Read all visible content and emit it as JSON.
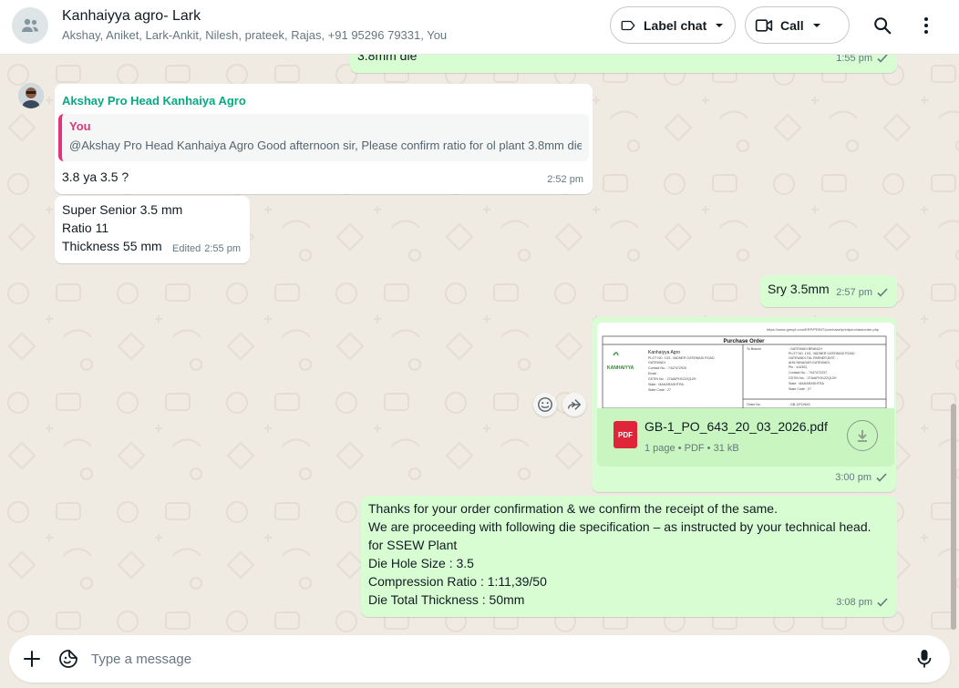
{
  "header": {
    "title": "Kanhaiyya agro- Lark",
    "members": "Akshay, Aniket, Lark-Ankit, Nilesh, prateek, Rajas, +91 95296 79331, You",
    "label_chat": "Label chat",
    "call": "Call"
  },
  "messages": {
    "m0": {
      "text": "3.8mm die",
      "time": "1:55 pm"
    },
    "m1": {
      "sender": "Akshay Pro Head Kanhaiya Agro",
      "quote_author": "You",
      "quote_text": "@Akshay Pro Head Kanhaiya Agro Good afternoon sir, Please confirm ratio for ol plant 3.8mm die",
      "text": "3.8 ya 3.5 ?",
      "time": "2:52 pm"
    },
    "m2": {
      "lines": [
        "Super Senior 3.5 mm",
        "Ratio 11",
        "Thickness 55 mm"
      ],
      "edited": "Edited",
      "time": "2:55 pm"
    },
    "m3": {
      "text": "Sry 3.5mm",
      "time": "2:57 pm"
    },
    "m4": {
      "preview": {
        "url": "https://www.gmcpl.com/ERP/PRINT/purchase/printpurchaseorder.php",
        "heading": "Purchase Order",
        "logo": "KANHAIYYA",
        "company": "Kanhaiyya Agro",
        "address_lines": [
          "PLOT NO. 13/1, VADNER GATEWADI ROAD",
          "GATEWADI",
          "Contact No. : 7447472933",
          "Email :",
          "GSTIN No. : 27AAIFK9122Q1ZH",
          "State : MAHARASHTRA",
          "State Code : 27"
        ],
        "to_branch": "To Branch",
        "to_lines": [
          ": GATEWADI BRANCH",
          "PLOT NO. 13/1, VADNER GATEWADI ROAD",
          "GATEWADI,TAL.PARNER,DIST. -",
          "AHILYANAGAR,GATEWADI,",
          "Pin : 414302,",
          "Contact No. : 7447472237,",
          "GSTIN No. : 27AAIFK9122Q1ZH",
          "State : MAHARASHTRA",
          "State Code : 27"
        ],
        "order_no_label": "Order No.",
        "order_no": ": GB-1/PO/643"
      },
      "file_name": "GB-1_PO_643_20_03_2026.pdf",
      "file_meta": "1 page • PDF • 31 kB",
      "pdf_badge": "PDF",
      "time": "3:00 pm"
    },
    "m5": {
      "lines": [
        "Thanks for your order confirmation & we confirm the receipt of the same.",
        "We are proceeding with following die specification –  as instructed by your technical head.",
        "for SSEW Plant",
        "Die Hole Size : 3.5",
        "Compression Ratio : 1:11,39/50",
        "Die Total Thickness : 50mm"
      ],
      "time": "3:08 pm"
    }
  },
  "composer": {
    "placeholder": "Type a message"
  },
  "icons": {
    "group_avatar": "group-icon",
    "label": "label-icon",
    "call": "video-call-icon",
    "search": "search-icon",
    "menu": "more-vertical-icon",
    "emoji": "emoji-icon",
    "forward": "forward-icon",
    "download": "download-icon",
    "attach": "plus-icon",
    "sticker": "sticker-icon",
    "mic": "mic-icon",
    "tick": "single-check-icon"
  },
  "colors": {
    "outgoing_bubble": "#d9fdd3",
    "incoming_bubble": "#ffffff",
    "sender_name": "#06a984",
    "quote_author": "#e0357a",
    "pdf_red": "#e0243a",
    "background": "#efeae2"
  }
}
